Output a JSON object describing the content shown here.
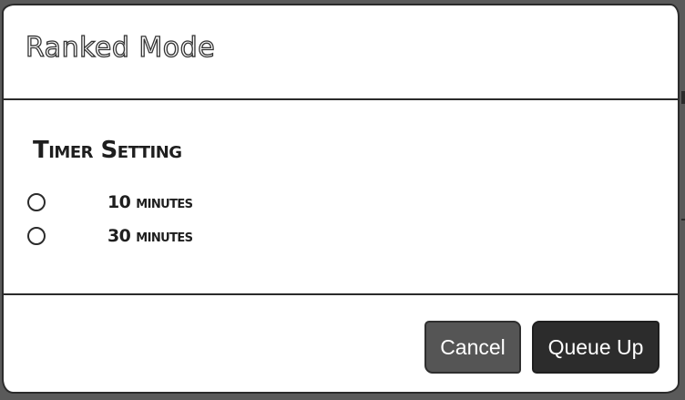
{
  "dialog": {
    "title": "Ranked Mode"
  },
  "timer": {
    "heading": "Timer Setting",
    "options": [
      {
        "label": "10 minutes",
        "selected": false
      },
      {
        "label": "30 minutes",
        "selected": false
      }
    ]
  },
  "actions": {
    "cancel_label": "Cancel",
    "queue_label": "Queue Up"
  },
  "colors": {
    "overlay": "#5a5a5a",
    "dialog_bg": "#ffffff",
    "border": "#2b2b2b",
    "cancel_bg": "#555555",
    "primary_bg": "#2c2c2c"
  }
}
